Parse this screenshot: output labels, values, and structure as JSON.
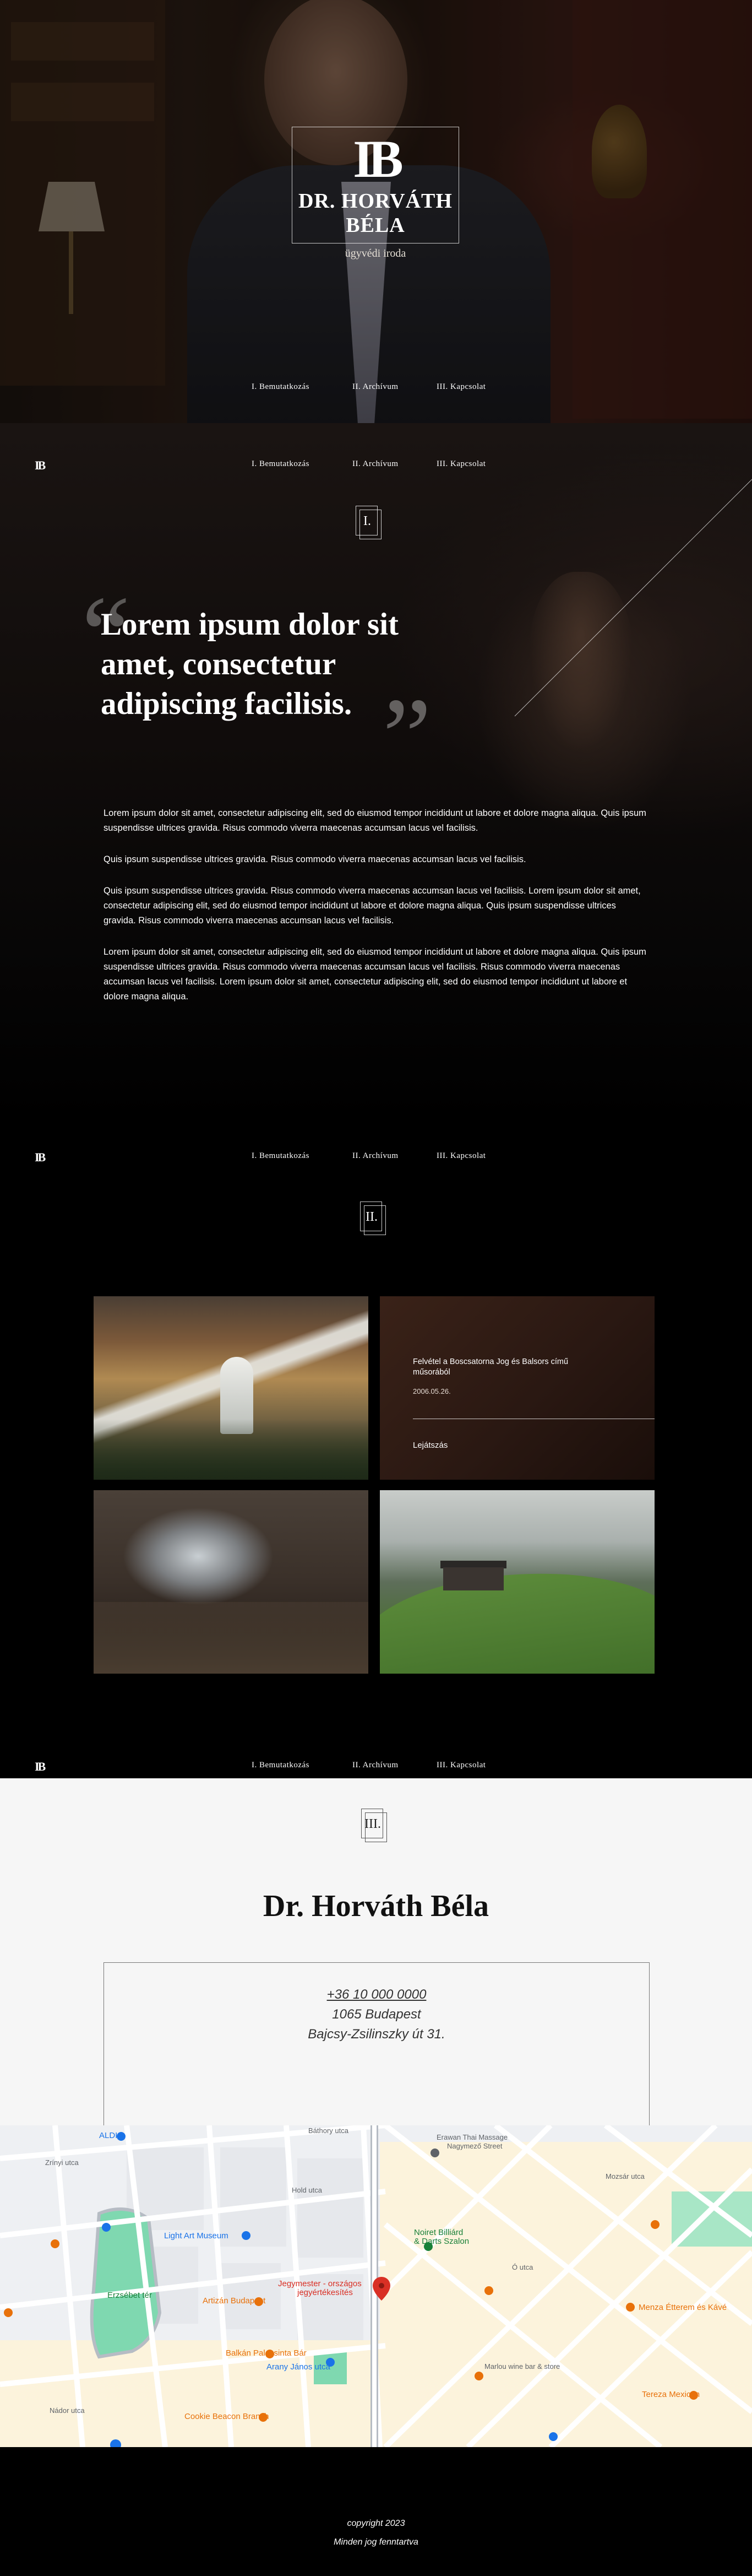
{
  "brand": {
    "monogram": "IB",
    "name": "DR. HORVÁTH BÉLA",
    "subtitle": "ügyvédi iroda"
  },
  "nav": {
    "logo": "IB",
    "items": [
      "I. Bemutatkozás",
      "II. Archívum",
      "III. Kapcsolat"
    ]
  },
  "intro": {
    "number": "I.",
    "quote": "Lorem ipsum dolor sit amet, consectetur adipiscing facilisis.",
    "paragraphs": [
      "Lorem ipsum dolor sit amet, consectetur adipiscing elit, sed do eiusmod tempor incididunt ut labore et dolore magna aliqua. Quis ipsum suspendisse ultrices gravida. Risus commodo viverra maecenas accumsan lacus vel facilisis.",
      "Quis ipsum suspendisse ultrices gravida. Risus commodo viverra maecenas accumsan lacus vel facilisis.",
      "Quis ipsum suspendisse ultrices gravida. Risus commodo viverra maecenas accumsan lacus vel facilisis. Lorem ipsum dolor sit amet, consectetur adipiscing elit, sed do eiusmod tempor incididunt ut labore et dolore magna aliqua. Quis ipsum suspendisse ultrices gravida. Risus commodo viverra maecenas accumsan lacus vel facilisis.",
      "Lorem ipsum dolor sit amet, consectetur adipiscing elit, sed do eiusmod tempor incididunt ut labore et dolore magna aliqua. Quis ipsum suspendisse ultrices gravida. Risus commodo viverra maecenas accumsan lacus vel facilisis. Risus commodo viverra maecenas accumsan lacus vel facilisis. Lorem ipsum dolor sit amet, consectetur adipiscing elit, sed do eiusmod tempor incididunt ut labore et dolore magna aliqua."
    ]
  },
  "archive": {
    "number": "II.",
    "video": {
      "title": "Felvétel a Boscsatorna Jog és Balsors című műsorából",
      "date": "2006.05.26.",
      "play_label": "Lejátszás"
    }
  },
  "contact": {
    "number": "III.",
    "name": "Dr. Horváth Béla",
    "phone": "+36 10 000 0000",
    "city": "1065 Budapest",
    "street": "Bajcsy-Zsilinszky út 31."
  },
  "map": {
    "labels": {
      "erawan": "Erawan Thai Massage",
      "erawan_sub": "Nagymező Street",
      "light_art": "Light Art Museum",
      "noiret": "Noiret Billiárd",
      "noiret_sub": "& Darts Szalon",
      "jegymester": "Jegymester - országos",
      "jegymester_sub": "jegyértékesítés",
      "artizan": "Artizán Budapest",
      "palacsinta": "Balkán Palacsinta Bár",
      "arany": "Arany János utca",
      "cookie": "Cookie Beacon Branch",
      "menza": "Menza Étterem és Kávé",
      "marlou": "Marlou wine bar & store",
      "tereza": "Tereza Mexican",
      "aldi": "ALDI",
      "erzsebet": "Erzsébet tér",
      "bathory": "Báthory utca",
      "zrinyi": "Zrínyi utca",
      "nador": "Nádor utca",
      "hold": "Hold utca",
      "mozsar": "Mozsár utca",
      "ozt": "Ó utca"
    }
  },
  "footer": {
    "copyright": "copyright 2023",
    "rights": "Minden jog fenntartva"
  },
  "colors": {
    "map_park": "#7fd8b0",
    "map_road": "#ffffff",
    "map_block_warm": "#fcf3dc",
    "pin_red": "#d93025"
  }
}
